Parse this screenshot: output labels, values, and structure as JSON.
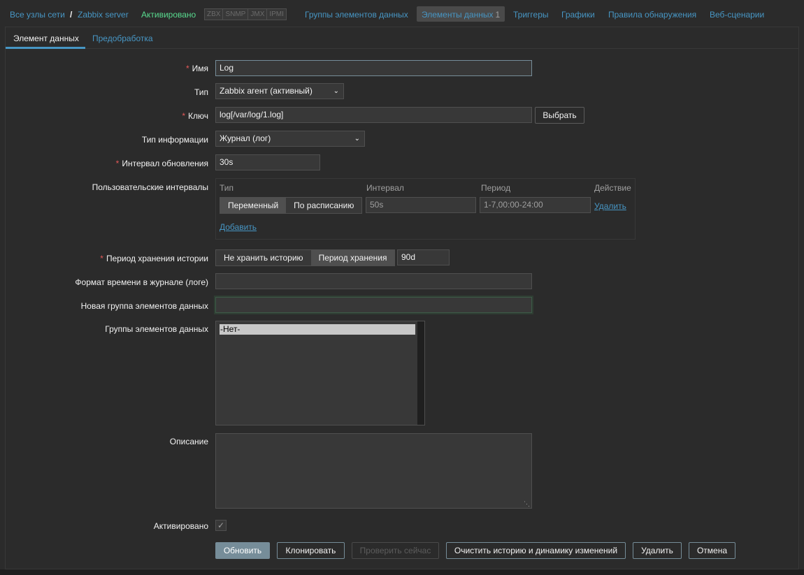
{
  "breadcrumbs": {
    "all_hosts": "Все узлы сети",
    "separator": "/",
    "host": "Zabbix server",
    "status": "Активировано"
  },
  "availability": [
    "ZBX",
    "SNMP",
    "JMX",
    "IPMI"
  ],
  "nav": {
    "item_groups": "Группы элементов данных",
    "items": "Элементы данных",
    "items_count": "1",
    "triggers": "Триггеры",
    "graphs": "Графики",
    "discovery": "Правила обнаружения",
    "web": "Веб-сценарии"
  },
  "tabs": {
    "item": "Элемент данных",
    "preprocessing": "Предобработка"
  },
  "form": {
    "name_label": "Имя",
    "name_value": "Log",
    "type_label": "Тип",
    "type_value": "Zabbix агент (активный)",
    "key_label": "Ключ",
    "key_value": "log[/var/log/1.log]",
    "select_button": "Выбрать",
    "info_type_label": "Тип информации",
    "info_type_value": "Журнал (лог)",
    "interval_label": "Интервал обновления",
    "interval_value": "30s",
    "custom_intervals_label": "Пользовательские интервалы",
    "custom_intervals": {
      "col_type": "Тип",
      "col_interval": "Интервал",
      "col_period": "Период",
      "col_action": "Действие",
      "type_flexible": "Переменный",
      "type_scheduling": "По расписанию",
      "interval_value": "50s",
      "period_value": "1-7,00:00-24:00",
      "remove": "Удалить",
      "add": "Добавить"
    },
    "history_label": "Период хранения истории",
    "history_no": "Не хранить историю",
    "history_period": "Период хранения",
    "history_value": "90d",
    "log_format_label": "Формат времени в журнале (логе)",
    "log_format_value": "",
    "new_group_label": "Новая группа элементов данных",
    "new_group_value": "",
    "groups_label": "Группы элементов данных",
    "groups_option": "-Нет-",
    "description_label": "Описание",
    "enabled_label": "Активировано",
    "enabled_mark": "✓"
  },
  "buttons": {
    "update": "Обновить",
    "clone": "Клонировать",
    "check_now": "Проверить сейчас",
    "clear_history": "Очистить историю и динамику изменений",
    "delete": "Удалить",
    "cancel": "Отмена"
  },
  "colors": {
    "background": "#2b2b2b",
    "link": "#4796c4",
    "enabled": "#59db8f",
    "required": "#e45959",
    "primary_button": "#768d99"
  }
}
